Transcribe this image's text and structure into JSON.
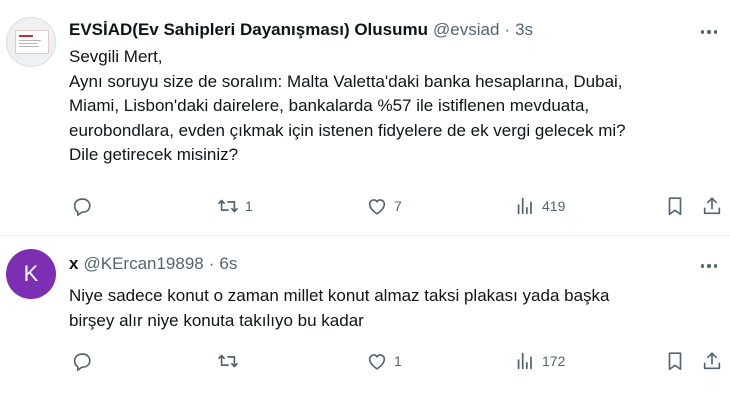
{
  "tweets": [
    {
      "name": "EVSİAD(Ev Sahipleri Dayanışması) Olusumu",
      "handle": "@evsiad",
      "dot": "·",
      "time": "3s",
      "lines": [
        "Sevgili Mert,",
        "Aynı soruyu size de soralım: Malta Valetta'daki banka hesaplarına, Dubai,",
        "Miami, Lisbon'daki dairelere, bankalarda %57 ile istiflenen mevduata,",
        "eurobondlara, evden çıkmak için istenen fidyelere de ek vergi gelecek mi?",
        "Dile getirecek misiniz?"
      ],
      "replies": "",
      "retweets": "1",
      "likes": "7",
      "views": "419"
    },
    {
      "avatar_letter": "K",
      "name": "x",
      "handle": "@KErcan19898",
      "dot": "·",
      "time": "6s",
      "lines": [
        "Niye sadece konut o zaman millet konut almaz taksi plakası yada başka",
        "birşey alır niye konuta takılıyo bu kadar"
      ],
      "replies": "",
      "retweets": "",
      "likes": "1",
      "views": "172"
    }
  ],
  "icons": {
    "reply": "reply-icon",
    "retweet": "retweet-icon",
    "like": "heart-icon",
    "views": "views-chart-icon",
    "bookmark": "bookmark-icon",
    "share": "share-icon",
    "more": "more-dots-icon"
  },
  "colors": {
    "text": "#0f1419",
    "secondary": "#536471",
    "divider": "#eff3f4",
    "avatar_letter_bg": "#7d2fb3"
  }
}
